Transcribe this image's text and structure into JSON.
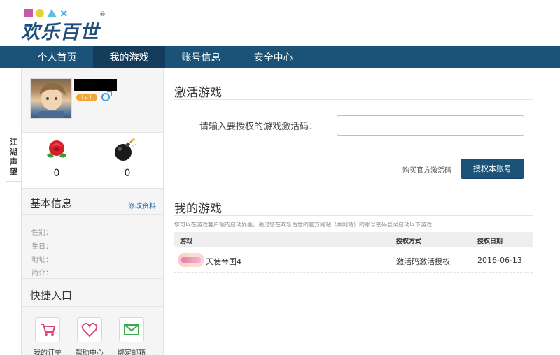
{
  "logo": {
    "text": "欢乐百世",
    "reg": "®"
  },
  "nav": {
    "items": [
      {
        "label": "个人首页",
        "active": false
      },
      {
        "label": "我的游戏",
        "active": true
      },
      {
        "label": "账号信息",
        "active": false
      },
      {
        "label": "安全中心",
        "active": false
      }
    ]
  },
  "sidebar": {
    "profile": {
      "level": "Lv.1"
    },
    "side_tab": [
      "江",
      "湖",
      "声",
      "望"
    ],
    "stats": [
      {
        "icon": "rose-icon",
        "value": "0"
      },
      {
        "icon": "bomb-icon",
        "value": "0"
      }
    ],
    "basic_info": {
      "title": "基本信息",
      "edit_label": "修改资料",
      "fields": [
        "性别：",
        "生日：",
        "地址：",
        "简介："
      ]
    },
    "quick": {
      "title": "快捷入口",
      "items": [
        {
          "label": "我的订单",
          "icon": "cart-icon",
          "color": "#e0457b"
        },
        {
          "label": "帮助中心",
          "icon": "heart-icon",
          "color": "#e0457b"
        },
        {
          "label": "绑定邮箱",
          "icon": "mail-icon",
          "color": "#3da74a"
        }
      ]
    }
  },
  "main": {
    "activate": {
      "title": "激活游戏",
      "code_label": "请输入要授权的游戏激活码：",
      "code_value": "",
      "buy_label": "购买官方激活码",
      "auth_button": "授权本账号"
    },
    "my_games": {
      "title": "我的游戏",
      "hint": "您可以在游戏客户端的启动界面，通过您在欢乐百世的官方网站（本网站）的账号密码登录启动以下游戏",
      "columns": [
        "游戏",
        "授权方式",
        "授权日期"
      ],
      "rows": [
        {
          "game": "天使帝国4",
          "method": "激活码激活授权",
          "date": "2016-06-13"
        }
      ]
    }
  },
  "colors": {
    "nav_bg": "#1a5278",
    "nav_active": "#143d5c",
    "link": "#1a5fa0",
    "level_badge": "#f3a733"
  }
}
